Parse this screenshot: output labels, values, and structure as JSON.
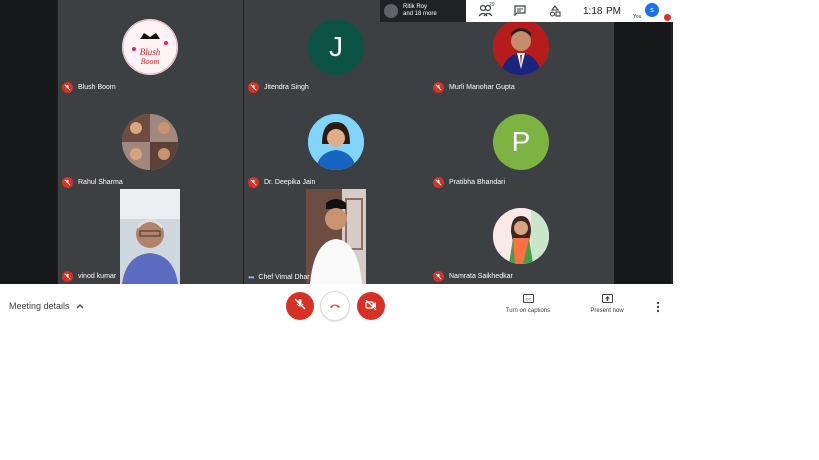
{
  "participants": [
    {
      "name": "Blush Boom",
      "status": "muted",
      "kind": "logo"
    },
    {
      "name": "Jitendra Singh",
      "status": "muted",
      "kind": "letter",
      "letter": "J",
      "color": "#0b5345"
    },
    {
      "name": "Murli Manohar Gupta",
      "status": "muted",
      "kind": "photo"
    },
    {
      "name": "Rahul Sharma",
      "status": "muted",
      "kind": "photo"
    },
    {
      "name": "Dr. Deepika Jain",
      "status": "muted",
      "kind": "photo"
    },
    {
      "name": "Pratibha Bhandari",
      "status": "muted",
      "kind": "letter",
      "letter": "P",
      "color": "#7cb342"
    },
    {
      "name": "vinod kumar",
      "status": "muted",
      "kind": "video"
    },
    {
      "name": "Chef Vimal Dhar",
      "status": "speaking",
      "kind": "video"
    },
    {
      "name": "Namrata Saikhedkar",
      "status": "muted",
      "kind": "photo"
    }
  ],
  "topbar": {
    "presenter_line1": "Ritik Roy",
    "presenter_line2": "and 18 more",
    "people_count": "29",
    "time": "1:18",
    "ampm": "PM",
    "user_initial": "s",
    "user_label": "You",
    "icons": [
      "people-icon",
      "chat-icon",
      "activities-icon"
    ]
  },
  "controls": {
    "meeting_details": "Meeting details",
    "captions_label": "Turn on captions",
    "present_label": "Present now"
  },
  "colors": {
    "mute_red": "#d93025",
    "meet_bg": "#202124",
    "tile_bg": "#3c4043"
  }
}
